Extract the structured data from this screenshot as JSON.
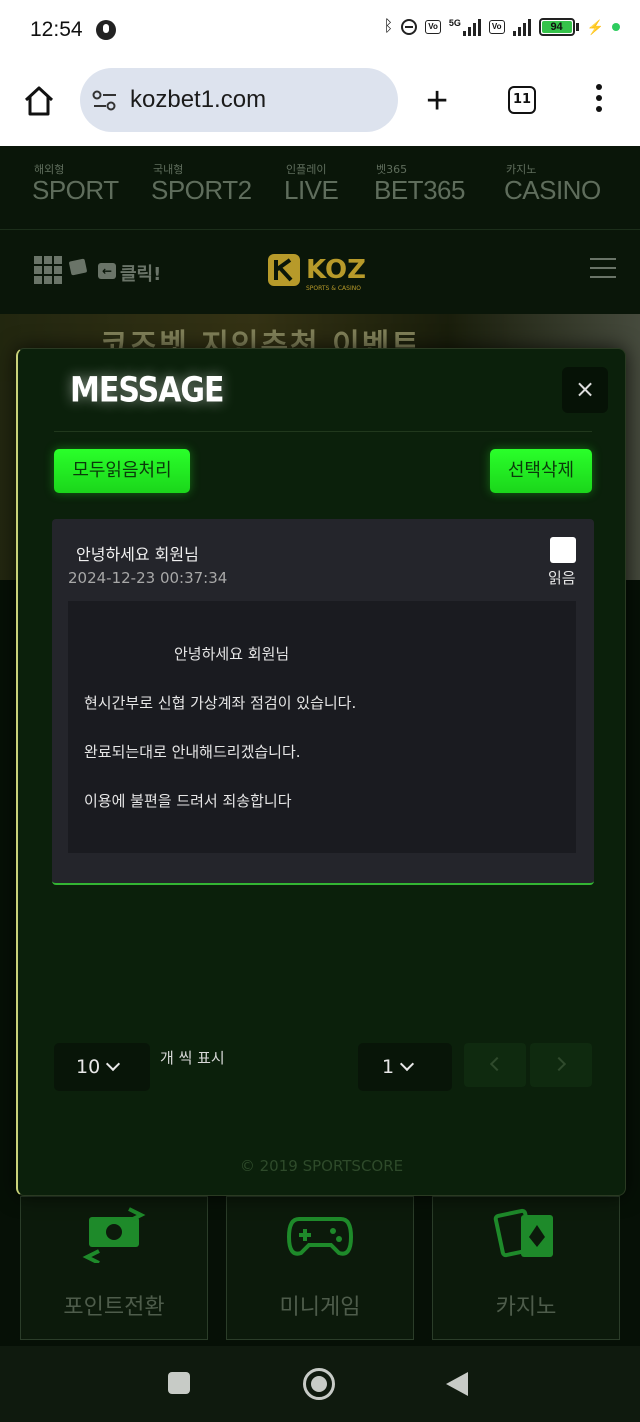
{
  "status_bar": {
    "time": "12:54",
    "battery": "94",
    "network": "5G"
  },
  "browser": {
    "url": "kozbet1.com",
    "tab_count": "11"
  },
  "site_nav": [
    {
      "small": "해외형",
      "big": "SPORT"
    },
    {
      "small": "국내형",
      "big": "SPORT2"
    },
    {
      "small": "인플레이",
      "big": "LIVE"
    },
    {
      "small": "벳365",
      "big": "BET365"
    },
    {
      "small": "카지노",
      "big": "CASINO"
    }
  ],
  "site_header": {
    "click_label": "클릭!",
    "logo_text": "KOZ",
    "logo_sub": "SPORTS & CASINO"
  },
  "banner": {
    "text": "코즈벳 지인추천 이벤트"
  },
  "modal": {
    "title": "MESSAGE",
    "close": "×",
    "mark_all_read": "모두읽음처리",
    "delete_selected": "선택삭제",
    "message": {
      "subject": "안녕하세요 회원님",
      "date": "2024-12-23 00:37:34",
      "read_label": "읽음",
      "body": [
        "안녕하세요 회원님",
        "현시간부로 신협 가상계좌 점검이 있습니다.",
        "완료되는대로 안내해드리겠습니다.",
        "이용에 불편을 드려서 죄송합니다"
      ]
    },
    "page_size": "10",
    "page_size_label": "개 씩 표시",
    "current_page": "1",
    "copyright": "© 2019 SPORTSCORE"
  },
  "bottom_tiles": [
    {
      "label": "포인트전환",
      "icon": "money-exchange-icon"
    },
    {
      "label": "미니게임",
      "icon": "gamepad-icon"
    },
    {
      "label": "카지노",
      "icon": "cards-icon"
    }
  ],
  "colors": {
    "accent_green": "#2aff2a",
    "modal_bg": "#0b200b",
    "card_bg": "#24252b"
  }
}
